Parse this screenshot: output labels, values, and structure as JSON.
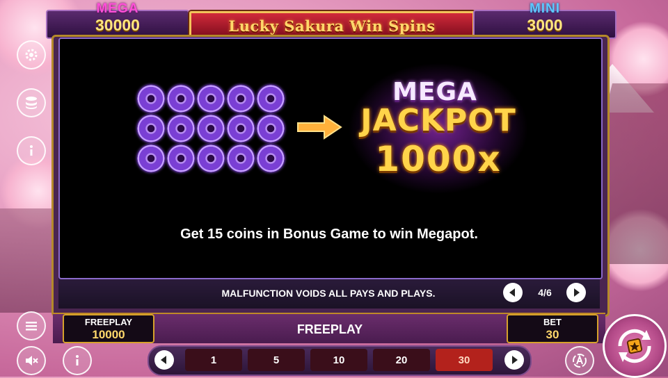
{
  "header": {
    "title": "Lucky Sakura Win Spins",
    "jackpot_left": {
      "label": "MEGA",
      "value": "30000"
    },
    "jackpot_right": {
      "label": "MINI",
      "value": "3000"
    }
  },
  "paytable": {
    "coin_count": 15,
    "mega_word": "MEGA",
    "jackpot_word": "JACKPOT",
    "multiplier": "1000x",
    "description": "Get 15 coins in Bonus Game to win Megapot.",
    "malfunction": "MALFUNCTION VOIDS ALL PAYS AND PLAYS.",
    "page": "4/6"
  },
  "wallet": {
    "balance_label": "FREEPLAY",
    "balance_value": "10000",
    "bet_label": "BET",
    "bet_value": "30",
    "mode_label": "FREEPLAY"
  },
  "bet_options": [
    "1",
    "5",
    "10",
    "20",
    "30"
  ],
  "selected_bet": "30",
  "colors": {
    "mega": "#ff4fd8",
    "mini": "#5ec8ff",
    "gold": "#ffd44a",
    "active_bet": "#b3221c"
  }
}
